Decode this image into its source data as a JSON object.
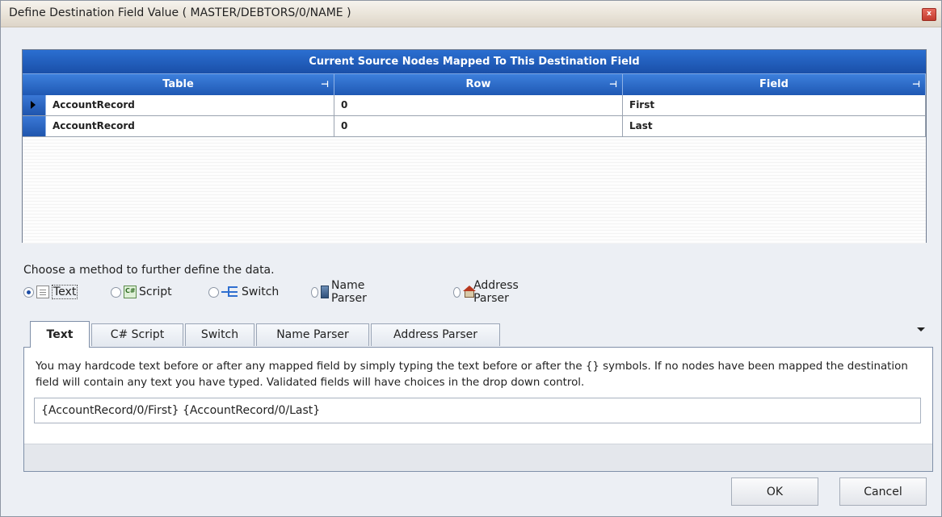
{
  "window": {
    "title": "Define Destination Field Value ( MASTER/DEBTORS/0/NAME )",
    "close_glyph": "x"
  },
  "grid": {
    "caption": "Current Source Nodes Mapped To This Destination Field",
    "columns": [
      "Table",
      "Row",
      "Field"
    ],
    "rows": [
      {
        "table": "AccountRecord",
        "row": "0",
        "field": "First"
      },
      {
        "table": "AccountRecord",
        "row": "0",
        "field": "Last"
      }
    ]
  },
  "methods": {
    "prompt": "Choose a method to further define the data.",
    "options": [
      {
        "label": "Text",
        "icon": "text-icon",
        "selected": true
      },
      {
        "label": "Script",
        "icon": "script-icon",
        "selected": false
      },
      {
        "label": "Switch",
        "icon": "switch-icon",
        "selected": false
      },
      {
        "label": "Name Parser",
        "icon": "name-parser-icon",
        "selected": false
      },
      {
        "label": "Address Parser",
        "icon": "address-parser-icon",
        "selected": false
      }
    ]
  },
  "tabs": {
    "items": [
      "Text",
      "C# Script",
      "Switch",
      "Name Parser",
      "Address Parser"
    ],
    "active": "Text"
  },
  "text_tab": {
    "description": "You may hardcode text before or after any mapped field by simply typing the text before or after the {} symbols.  If no nodes have been mapped the destination field will contain any text you have typed.  Validated fields will have choices in the drop down control.",
    "value": "{AccountRecord/0/First} {AccountRecord/0/Last}"
  },
  "buttons": {
    "ok": "OK",
    "cancel": "Cancel"
  },
  "colors": {
    "grid_header": "#1f58b3",
    "grid_caption": "#1a4fa8"
  }
}
